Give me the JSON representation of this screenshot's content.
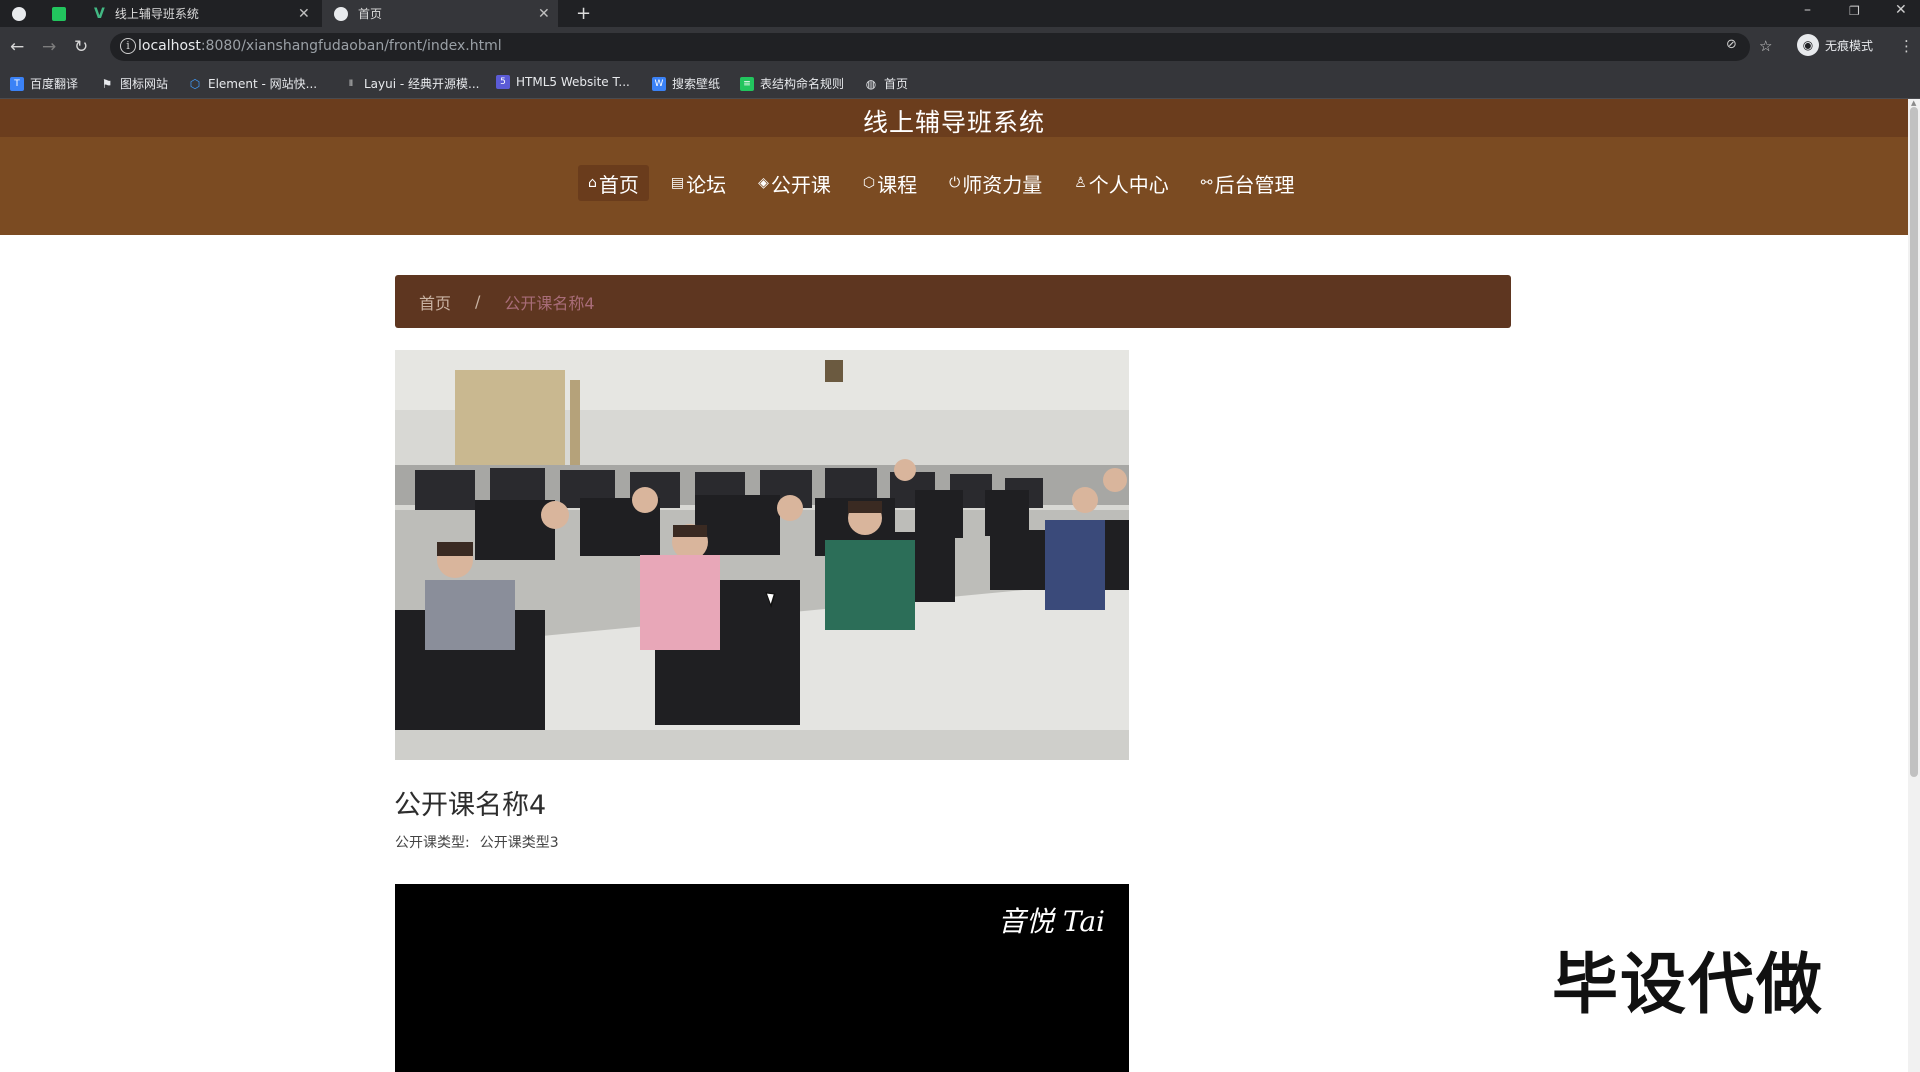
{
  "browser": {
    "tabs": [
      {
        "title": ""
      },
      {
        "title": ""
      },
      {
        "title": "线上辅导班系统"
      },
      {
        "title": "首页"
      }
    ],
    "new_tab_label": "+",
    "url": {
      "host": "localhost",
      "rest": ":8080/xianshangfudaoban/front/index.html"
    },
    "incognito_label": "无痕模式",
    "bookmarks": [
      {
        "label": "百度翻译",
        "icon": "translate-icon",
        "color": "#3b82f6"
      },
      {
        "label": "图标网站",
        "icon": "flag-icon",
        "color": "#e8eaed"
      },
      {
        "label": "Element - 网站快...",
        "icon": "element-icon",
        "color": "#409eff"
      },
      {
        "label": "Layui - 经典开源模...",
        "icon": "layui-icon",
        "color": "#cccccc"
      },
      {
        "label": "HTML5 Website T...",
        "icon": "html5-icon",
        "color": "#5b5bd6"
      },
      {
        "label": "搜索壁纸",
        "icon": "wallpaper-icon",
        "color": "#3b82f6"
      },
      {
        "label": "表结构命名规则",
        "icon": "sheet-icon",
        "color": "#22c55e"
      },
      {
        "label": "首页",
        "icon": "globe-icon",
        "color": "#e8eaed"
      }
    ]
  },
  "site": {
    "title": "线上辅导班系统",
    "nav": [
      {
        "label": "首页",
        "icon": "home-icon",
        "glyph": "⌂",
        "active": true
      },
      {
        "label": "论坛",
        "icon": "forum-icon",
        "glyph": "▤",
        "active": false
      },
      {
        "label": "公开课",
        "icon": "layers-icon",
        "glyph": "◈",
        "active": false
      },
      {
        "label": "课程",
        "icon": "box-icon",
        "glyph": "⬡",
        "active": false
      },
      {
        "label": "师资力量",
        "icon": "power-icon",
        "glyph": "⏻",
        "active": false
      },
      {
        "label": "个人中心",
        "icon": "user-icon",
        "glyph": "♙",
        "active": false
      },
      {
        "label": "后台管理",
        "icon": "link-icon",
        "glyph": "⚯",
        "active": false
      }
    ],
    "colors": {
      "title_bar": "#6b3d1d",
      "nav_bar": "#7b4b22",
      "breadcrumb": "#5e3620"
    }
  },
  "breadcrumb": {
    "home": "首页",
    "separator": "/",
    "current": "公开课名称4"
  },
  "course": {
    "name": "公开课名称4",
    "type_label": "公开课类型:",
    "type_value": "公开课类型3"
  },
  "video": {
    "watermark": "音悦 Tai"
  },
  "overlay_watermark": "毕设代做"
}
